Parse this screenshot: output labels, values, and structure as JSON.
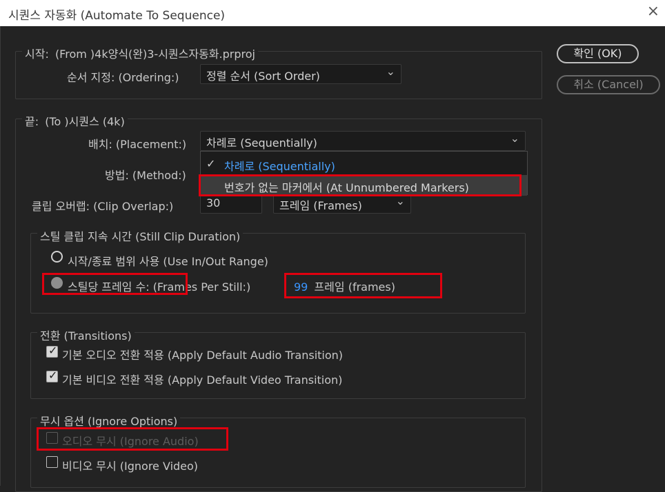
{
  "window": {
    "title": "시퀀스 자동화 (Automate To Sequence)",
    "close_glyph": "×"
  },
  "from": {
    "label": "시작:",
    "value": "(From )4k양식(완)3-시퀀스자동화.prproj",
    "ordering_label": "순서 지정: (Ordering:)",
    "ordering_value": "정렬 순서 (Sort Order)"
  },
  "to": {
    "label": "끝:",
    "value": "(To )시퀀스 (4k)",
    "placement_label": "배치: (Placement:)",
    "placement_value": "차례로 (Sequentially)",
    "method_label": "방법: (Method:)",
    "clip_overlap_label": "클립 오버랩: (Clip Overlap:)",
    "clip_overlap_value": "30",
    "overlap_unit": "프레임 (Frames)"
  },
  "placement_menu": {
    "items": [
      {
        "label": "차례로 (Sequentially)",
        "checked": true
      },
      {
        "label": "번호가 없는 마커에서 (At Unnumbered Markers)",
        "checked": false
      }
    ],
    "check_glyph": "✓"
  },
  "still_clip": {
    "title": "스틸 클립 지속 시간 (Still Clip Duration)",
    "use_in_out": "시작/종료 범위 사용 (Use In/Out Range)",
    "frames_per_still_label": "스틸당 프레임 수: (Frames Per Still:)",
    "frames_value": "99",
    "frames_unit": "프레임 (frames)"
  },
  "transitions": {
    "title": "전환 (Transitions)",
    "audio": "기본 오디오 전환 적용 (Apply Default Audio Transition)",
    "video": "기본 비디오 전환 적용 (Apply Default Video Transition)",
    "check_glyph": "✓"
  },
  "ignore": {
    "title": "무시 옵션 (Ignore Options)",
    "audio": "오디오 무시 (Ignore Audio)",
    "video": "비디오 무시 (Ignore Video)"
  },
  "buttons": {
    "ok": "확인 (OK)",
    "cancel": "취소 (Cancel)"
  },
  "chevron_glyph": "⌄",
  "colors": {
    "accent_blue": "#3a95ff",
    "highlight_red": "#e0000f",
    "background": "#232323"
  }
}
